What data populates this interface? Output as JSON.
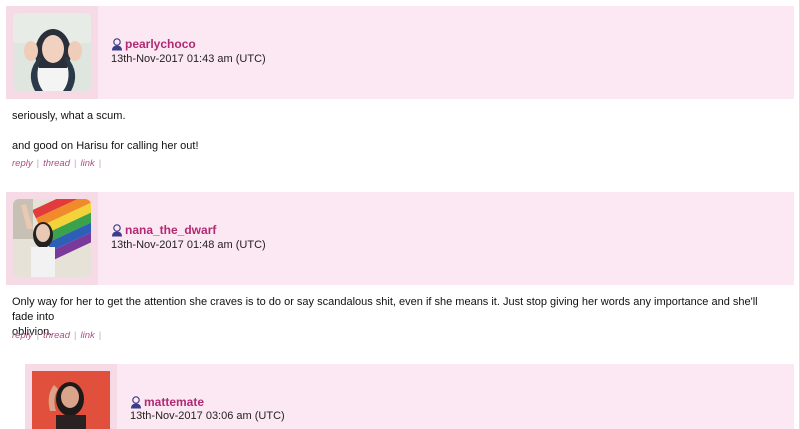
{
  "comments": [
    {
      "username": "pearlychoco",
      "timestamp": "13th-Nov-2017 01:43 am (UTC)",
      "body": [
        "seriously, what a scum.",
        "and good on Harisu for calling her out!"
      ],
      "actions": [
        "reply",
        "thread",
        "link"
      ],
      "avatar_icon": "avatar-photo"
    },
    {
      "username": "nana_the_dwarf",
      "timestamp": "13th-Nov-2017 01:48 am (UTC)",
      "body": [
        "Only way for her to get the attention she craves is to do or say scandalous shit, even if she means it. Just stop giving her words any importance and she'll fade into",
        "oblivion."
      ],
      "actions": [
        "reply",
        "thread",
        "link"
      ],
      "avatar_icon": "avatar-photo"
    },
    {
      "username": "mattemate",
      "timestamp": "13th-Nov-2017 03:06 am (UTC)",
      "avatar_icon": "avatar-photo"
    }
  ],
  "colors": {
    "header_bg": "#fce8f2",
    "avatar_cell_bg": "#f6dbe6",
    "username": "#b02a73",
    "action_link": "#b24c86"
  }
}
